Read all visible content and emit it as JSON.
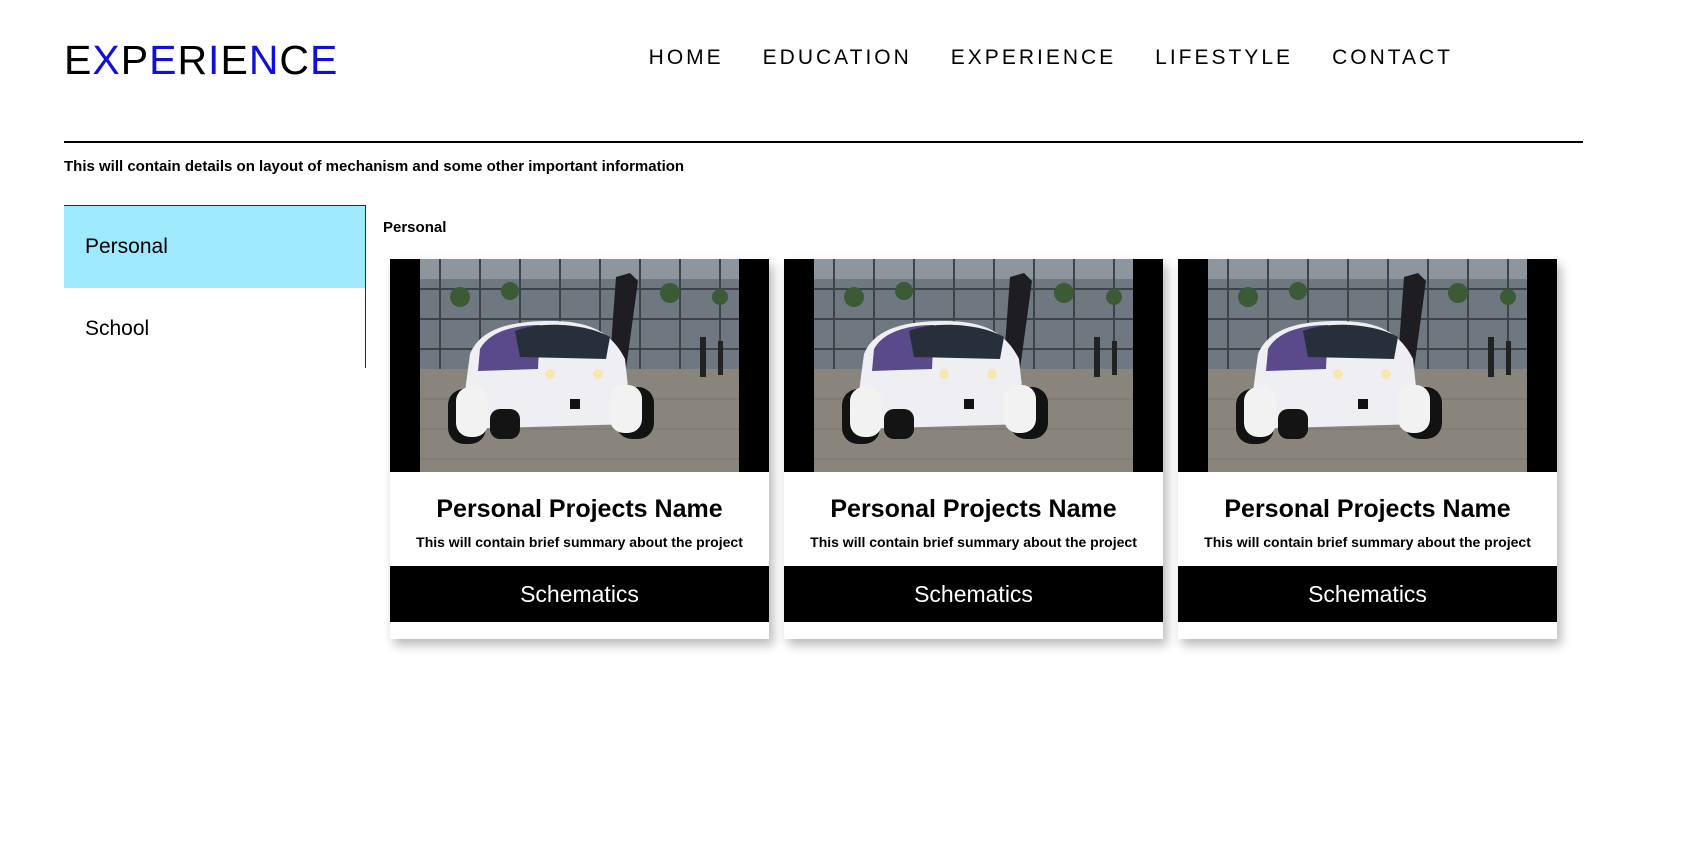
{
  "header": {
    "logo_letters": [
      {
        "ch": "E",
        "blue": false
      },
      {
        "ch": "X",
        "blue": true
      },
      {
        "ch": "P",
        "blue": false
      },
      {
        "ch": "E",
        "blue": true
      },
      {
        "ch": "R",
        "blue": false
      },
      {
        "ch": "I",
        "blue": true
      },
      {
        "ch": "E",
        "blue": false
      },
      {
        "ch": "N",
        "blue": true
      },
      {
        "ch": "C",
        "blue": false
      },
      {
        "ch": "E",
        "blue": true
      }
    ],
    "nav": [
      "HOME",
      "EDUCATION",
      "EXPERIENCE",
      "LIFESTYLE",
      "CONTACT"
    ]
  },
  "intro": "This will contain details on layout of mechanism and some other important information",
  "sidebar": {
    "items": [
      {
        "label": "Personal",
        "active": true
      },
      {
        "label": "School",
        "active": false
      }
    ]
  },
  "main": {
    "section_label": "Personal",
    "cards": [
      {
        "title": "Personal Projects Name",
        "desc": "This will contain brief summary about the project",
        "button": "Schematics"
      },
      {
        "title": "Personal Projects Name",
        "desc": "This will contain brief summary about the project",
        "button": "Schematics"
      },
      {
        "title": "Personal Projects Name",
        "desc": "This will contain brief summary about the project",
        "button": "Schematics"
      }
    ]
  },
  "colors": {
    "accent_blue": "#1010d8",
    "active_tab": "#9fe9fd",
    "button_bg": "#000000",
    "button_text": "#ffffff"
  }
}
